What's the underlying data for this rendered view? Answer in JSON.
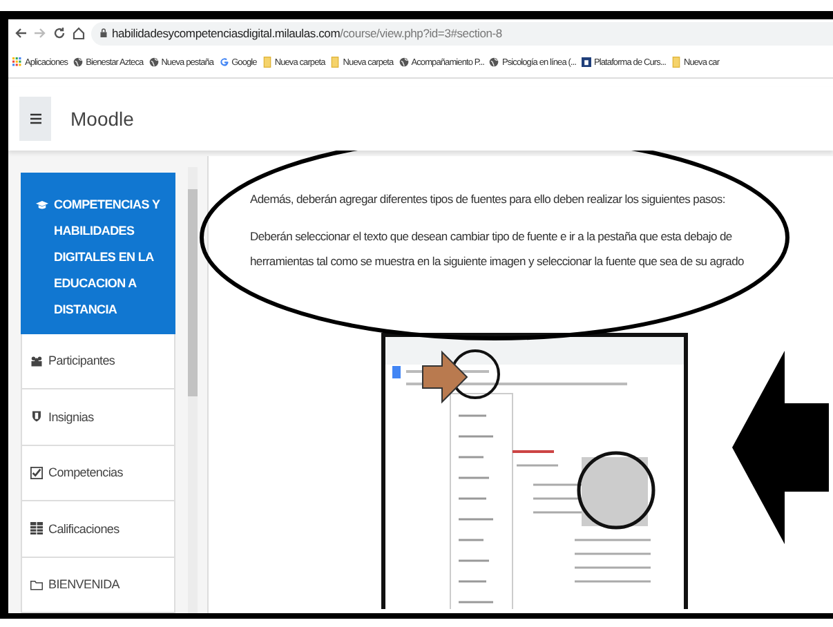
{
  "browser": {
    "url_host": "habilidadesycompetenciasdigital.milaulas.com",
    "url_path": "/course/view.php?id=3#section-8"
  },
  "bookmarks": [
    {
      "label": "Aplicaciones",
      "kind": "apps"
    },
    {
      "label": "Bienestar Azteca",
      "kind": "site"
    },
    {
      "label": "Nueva pestaña",
      "kind": "site"
    },
    {
      "label": "Google",
      "kind": "google"
    },
    {
      "label": "Nueva carpeta",
      "kind": "folder"
    },
    {
      "label": "Nueva carpeta",
      "kind": "folder"
    },
    {
      "label": "Acompañamiento P...",
      "kind": "site"
    },
    {
      "label": "Psicología en línea (...",
      "kind": "site"
    },
    {
      "label": "Plataforma de Curs...",
      "kind": "platform"
    },
    {
      "label": "Nueva car",
      "kind": "folder"
    }
  ],
  "header": {
    "title": "Moodle"
  },
  "sidebar": {
    "items": [
      {
        "label": "COMPETENCIAS Y HABILIDADES DIGITALES EN LA EDUCACION A DISTANCIA",
        "kind": "course",
        "selected": true
      },
      {
        "label": "Participantes",
        "kind": "participants",
        "selected": false
      },
      {
        "label": "Insignias",
        "kind": "badges",
        "selected": false
      },
      {
        "label": "Competencias",
        "kind": "competencies",
        "selected": false
      },
      {
        "label": "Calificaciones",
        "kind": "grades",
        "selected": false
      },
      {
        "label": "BIENVENIDA",
        "kind": "section",
        "selected": false
      }
    ]
  },
  "content": {
    "paragraphs": [
      "Además, deberán agregar diferentes tipos de fuentes para ello deben realizar los siguientes pasos:",
      "Deberán seleccionar el texto que desean cambiar tipo de fuente e ir a la pestaña que esta debajo de herramientas tal como se muestra en la siguiente imagen y seleccionar la fuente que sea de su agrado"
    ]
  }
}
